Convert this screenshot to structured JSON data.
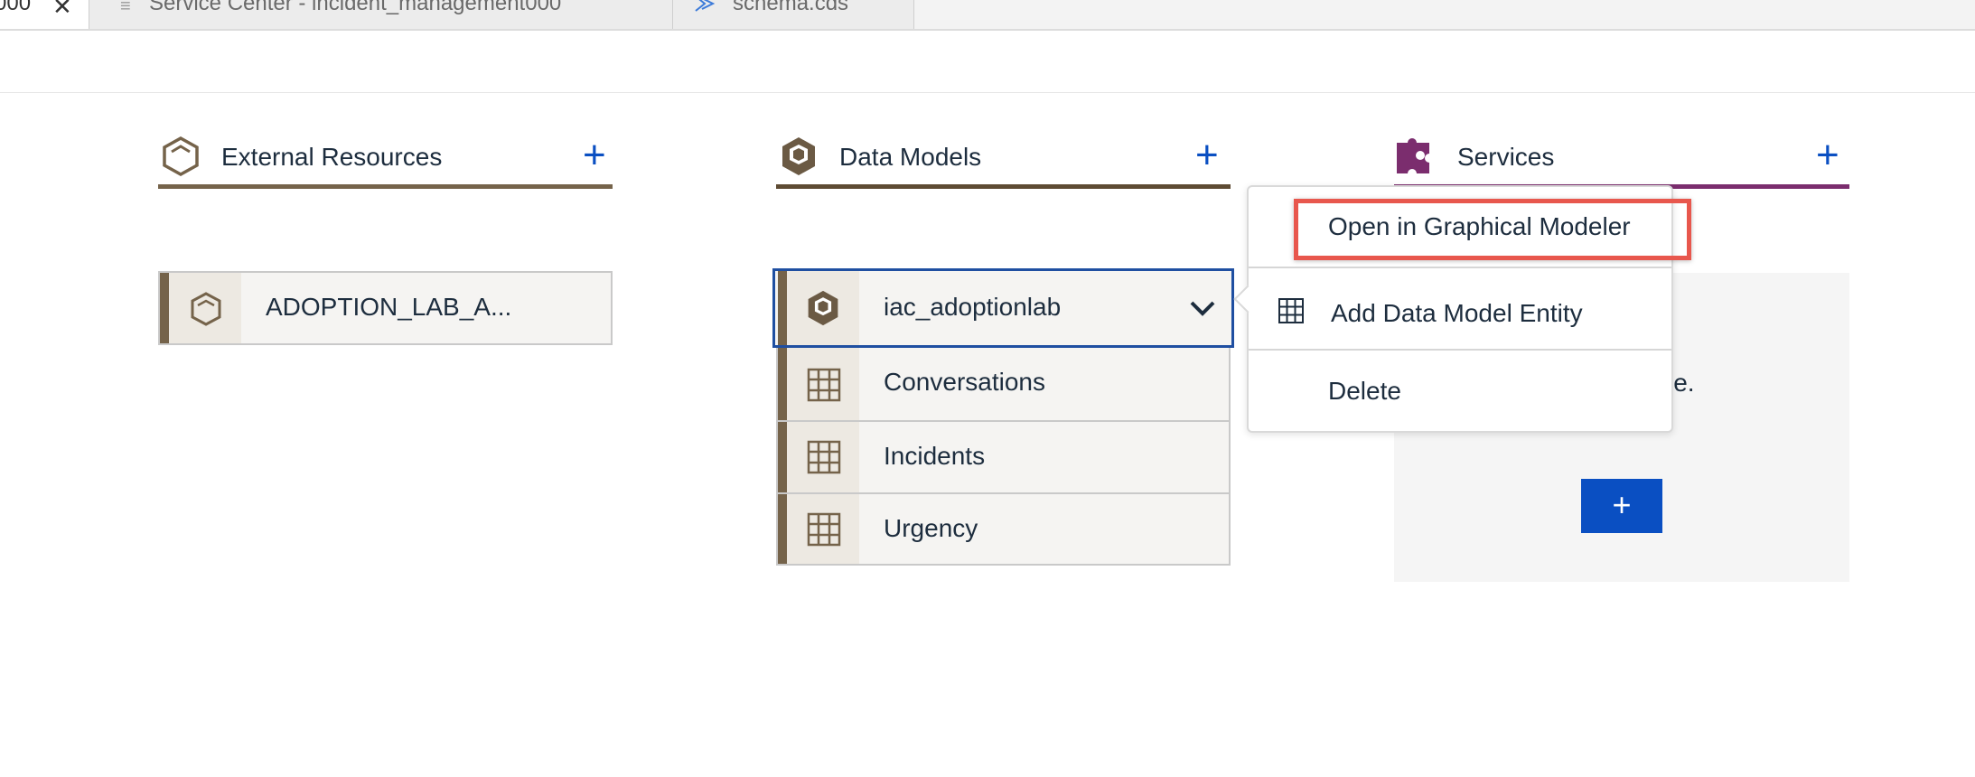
{
  "tabs": [
    {
      "label": "000"
    },
    {
      "label": "Service Center - incident_management000"
    },
    {
      "label": "schema.cds"
    }
  ],
  "columns": {
    "external": {
      "title": "External Resources",
      "add_label": "+"
    },
    "models": {
      "title": "Data Models",
      "add_label": "+"
    },
    "services": {
      "title": "Services",
      "add_label": "+"
    }
  },
  "external_items": [
    {
      "label": "ADOPTION_LAB_A..."
    }
  ],
  "model": {
    "name": "iac_adoptionlab",
    "entities": [
      {
        "label": "Conversations"
      },
      {
        "label": "Incidents"
      },
      {
        "label": "Urgency"
      }
    ]
  },
  "context_menu": {
    "items": [
      {
        "label": "Open in Graphical Modeler"
      },
      {
        "label": "Add Data Model Entity"
      },
      {
        "label": "Delete"
      }
    ]
  },
  "services_panel": {
    "partial_text": "vice.",
    "button_label": "+"
  },
  "colors": {
    "accent_blue": "#0a4fc2",
    "brown": "#75634a",
    "services_purple": "#7b2d6e",
    "highlight_red": "#e8574d"
  },
  "icons": {
    "tab_close": "close-icon",
    "external": "hexagon-outline-icon",
    "models": "cubes-icon",
    "services": "puzzle-icon",
    "entity": "table-grid-icon",
    "expand": "chevron-down-icon"
  }
}
